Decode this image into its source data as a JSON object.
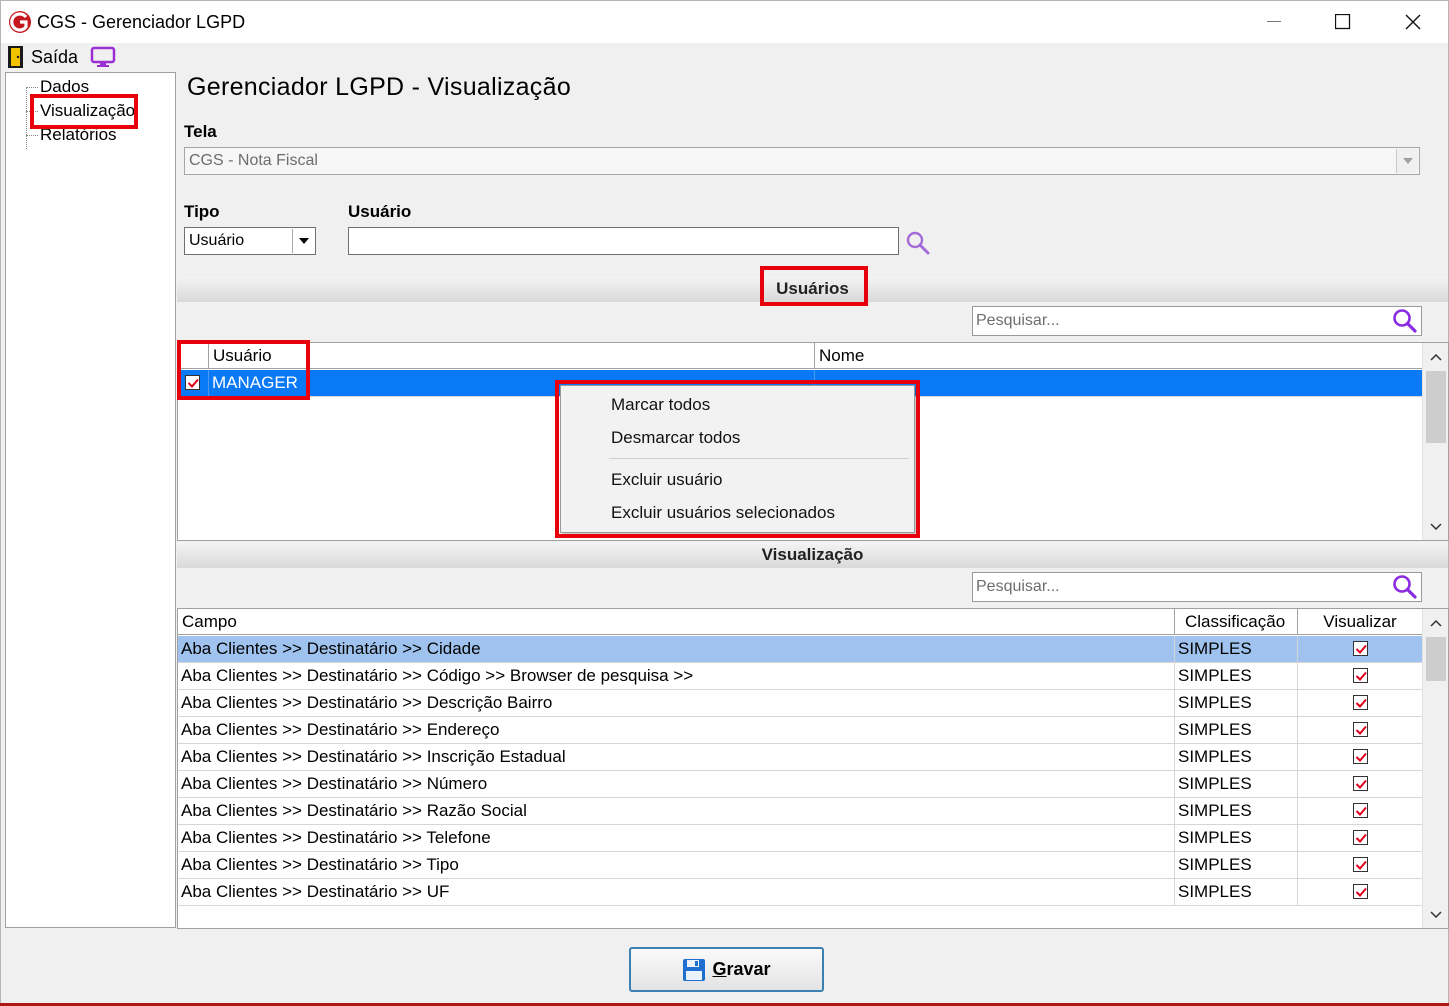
{
  "window": {
    "title": "CGS - Gerenciador LGPD",
    "logo_letter": "G"
  },
  "menubar": {
    "exit_label": "Saída"
  },
  "tree": {
    "items": [
      {
        "label": "Dados"
      },
      {
        "label": "Visualização",
        "selected": true
      },
      {
        "label": "Relatórios"
      }
    ]
  },
  "header": {
    "title": "Gerenciador LGPD - Visualização"
  },
  "form": {
    "tela_label": "Tela",
    "tela_value": "CGS - Nota Fiscal",
    "tipo_label": "Tipo",
    "tipo_value": "Usuário",
    "usuario_label": "Usuário",
    "usuario_value": ""
  },
  "usuarios": {
    "section_title": "Usuários",
    "search_placeholder": "Pesquisar...",
    "columns": [
      "Usuário",
      "Nome"
    ],
    "rows": [
      {
        "checked": true,
        "usuario": "MANAGER",
        "nome": ""
      }
    ]
  },
  "context_menu": {
    "items": [
      "Marcar todos",
      "Desmarcar todos",
      "Excluir usuário",
      "Excluir usuários selecionados"
    ]
  },
  "visualizacao": {
    "section_title": "Visualização",
    "search_placeholder": "Pesquisar...",
    "columns": [
      "Campo",
      "Classificação",
      "Visualizar"
    ],
    "rows": [
      {
        "campo": "Aba Clientes >> Destinatário >> Cidade",
        "classificacao": "SIMPLES",
        "visualizar": true
      },
      {
        "campo": "Aba Clientes >> Destinatário >> Código >> Browser de pesquisa >>",
        "classificacao": "SIMPLES",
        "visualizar": true
      },
      {
        "campo": "Aba Clientes >> Destinatário >> Descrição Bairro",
        "classificacao": "SIMPLES",
        "visualizar": true
      },
      {
        "campo": "Aba Clientes >> Destinatário >> Endereço",
        "classificacao": "SIMPLES",
        "visualizar": true
      },
      {
        "campo": "Aba Clientes >> Destinatário >> Inscrição Estadual",
        "classificacao": "SIMPLES",
        "visualizar": true
      },
      {
        "campo": "Aba Clientes >> Destinatário >> Número",
        "classificacao": "SIMPLES",
        "visualizar": true
      },
      {
        "campo": "Aba Clientes >> Destinatário >> Razão Social",
        "classificacao": "SIMPLES",
        "visualizar": true
      },
      {
        "campo": "Aba Clientes >> Destinatário >> Telefone",
        "classificacao": "SIMPLES",
        "visualizar": true
      },
      {
        "campo": "Aba Clientes >> Destinatário >> Tipo",
        "classificacao": "SIMPLES",
        "visualizar": true
      },
      {
        "campo": "Aba Clientes >> Destinatário >> UF",
        "classificacao": "SIMPLES",
        "visualizar": true
      }
    ]
  },
  "footer": {
    "gravar_underlined": "G",
    "gravar_rest": "ravar"
  },
  "colors": {
    "highlight_red": "#e8000d",
    "selection_blue": "#0a79f5",
    "selection_light": "#9fc3ee",
    "accent_purple": "#9b2fd6"
  }
}
